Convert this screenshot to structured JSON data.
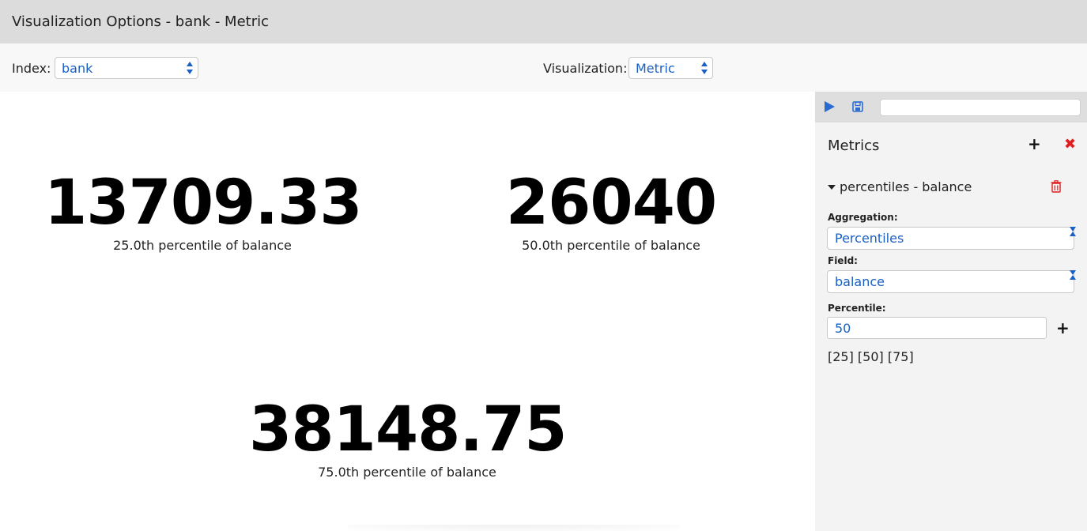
{
  "window": {
    "title": "Visualization Options - bank - Metric"
  },
  "options": {
    "index_label": "Index:",
    "index_value": "bank",
    "visualization_label": "Visualization:",
    "visualization_value": "Metric"
  },
  "metrics_display": [
    {
      "value": "13709.33",
      "label": "25.0th percentile of balance"
    },
    {
      "value": "26040",
      "label": "50.0th percentile of balance"
    },
    {
      "value": "38148.75",
      "label": "75.0th percentile of balance"
    }
  ],
  "panel": {
    "heading": "Metrics",
    "add_symbol": "+",
    "remove_symbol": "✖",
    "aggregation_title": "percentiles - balance",
    "aggregation_label": "Aggregation:",
    "aggregation_value": "Percentiles",
    "field_label": "Field:",
    "field_value": "balance",
    "percentile_label": "Percentile:",
    "percentile_value": "50",
    "percentile_add_symbol": "+",
    "percentile_list": "[25] [50] [75]"
  },
  "colors": {
    "accent": "#1a5fc4",
    "danger": "#e01e1e",
    "titlebar": "#dcdcdc"
  }
}
